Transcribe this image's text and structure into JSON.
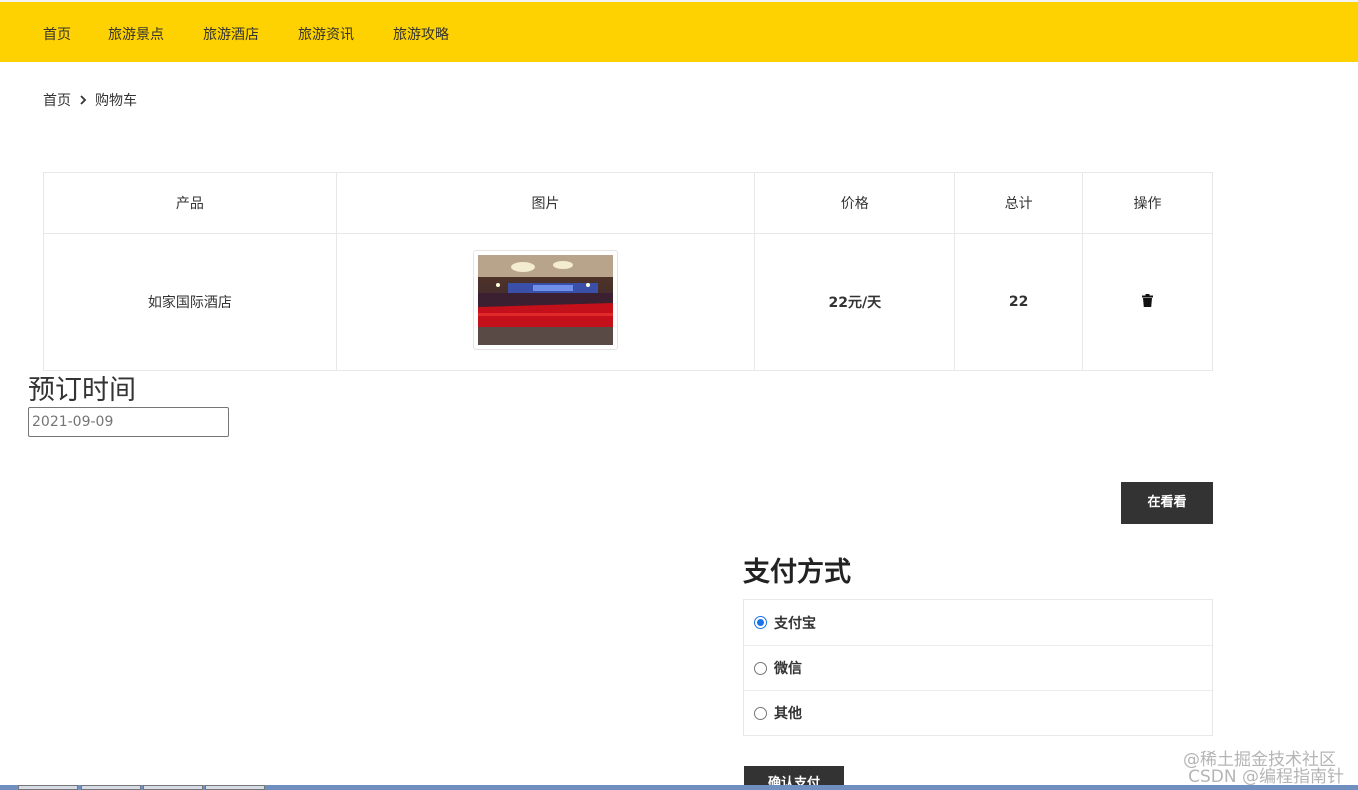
{
  "nav": {
    "items": [
      {
        "label": "首页"
      },
      {
        "label": "旅游景点"
      },
      {
        "label": "旅游酒店"
      },
      {
        "label": "旅游资讯"
      },
      {
        "label": "旅游攻略"
      }
    ]
  },
  "breadcrumb": {
    "home": "首页",
    "current": "购物车",
    "separator_icon": "chevron-right-icon"
  },
  "cart": {
    "headers": [
      "产品",
      "图片",
      "价格",
      "总计",
      "操作"
    ],
    "rows": [
      {
        "product": "如家国际酒店",
        "image_icon": "hotel-ballroom-photo",
        "price": "22元/天",
        "total": "22",
        "action_icon": "trash-icon"
      }
    ]
  },
  "booking": {
    "label": "预订时间",
    "date_value": "2021-09-09"
  },
  "buttons": {
    "look_again": "在看看",
    "confirm_pay": "确认支付"
  },
  "payment": {
    "title": "支付方式",
    "options": [
      {
        "label": "支付宝",
        "checked": true
      },
      {
        "label": "微信",
        "checked": false
      },
      {
        "label": "其他",
        "checked": false
      }
    ]
  },
  "watermark": {
    "line1": "@稀土掘金技术社区",
    "line2": "CSDN @编程指南针"
  },
  "colors": {
    "header_bg": "#fed200",
    "button_bg": "#333333",
    "radio_accent": "#1a73e8"
  }
}
